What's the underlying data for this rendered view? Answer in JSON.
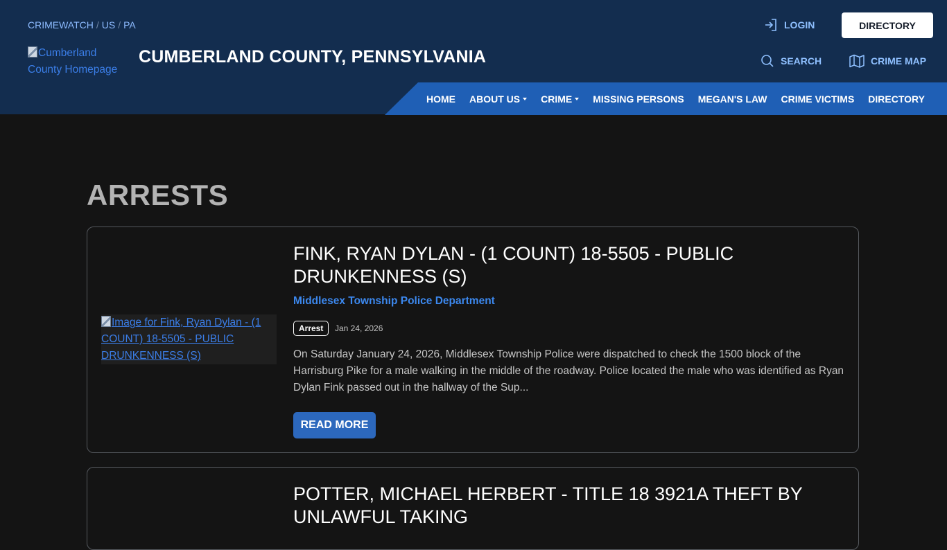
{
  "breadcrumb": [
    "CRIMEWATCH",
    "US",
    "PA"
  ],
  "breadcrumb_separator": "/",
  "logo_alt": "Cumberland County Homepage",
  "site_title": "CUMBERLAND COUNTY, PENNSYLVANIA",
  "utility": {
    "login": "LOGIN",
    "directory": "DIRECTORY",
    "search": "SEARCH",
    "crime_map": "CRIME MAP"
  },
  "nav": {
    "items": [
      {
        "label": "HOME",
        "dropdown": false
      },
      {
        "label": "ABOUT US",
        "dropdown": true
      },
      {
        "label": "CRIME",
        "dropdown": true
      },
      {
        "label": "MISSING PERSONS",
        "dropdown": false
      },
      {
        "label": "MEGAN'S LAW",
        "dropdown": false
      },
      {
        "label": "CRIME VICTIMS",
        "dropdown": false
      },
      {
        "label": "DIRECTORY",
        "dropdown": false
      }
    ]
  },
  "page_heading": "ARRESTS",
  "posts": [
    {
      "image_alt": "Image for Fink, Ryan Dylan - (1 COUNT) 18-5505 - PUBLIC DRUNKENNESS (S)",
      "title": "FINK, RYAN DYLAN - (1 COUNT) 18-5505 - PUBLIC DRUNKENNESS (S)",
      "agency": "Middlesex Township Police Department",
      "badge": "Arrest",
      "date": "Jan 24, 2026",
      "excerpt": "On Saturday January 24, 2026, Middlesex Township Police were dispatched to check the 1500 block of the Harrisburg Pike for a male walking in the middle of the roadway.  Police located the male who was identified as Ryan Dylan Fink passed out in the hallway of the Sup...",
      "read_more": "READ MORE"
    },
    {
      "title": "POTTER, MICHAEL HERBERT - TITLE 18 3921A THEFT BY UNLAWFUL TAKING"
    }
  ],
  "colors": {
    "header_bg": "#132d4f",
    "nav_bg": "#1f5fb5",
    "page_bg": "#141414",
    "link_blue": "#3c88ee",
    "button_blue": "#2c68bd"
  },
  "icons": {
    "login": "login-arrow-icon",
    "search": "search-icon",
    "crime_map": "map-icon",
    "dropdown": "caret-down-icon",
    "broken_image": "broken-image-icon"
  }
}
